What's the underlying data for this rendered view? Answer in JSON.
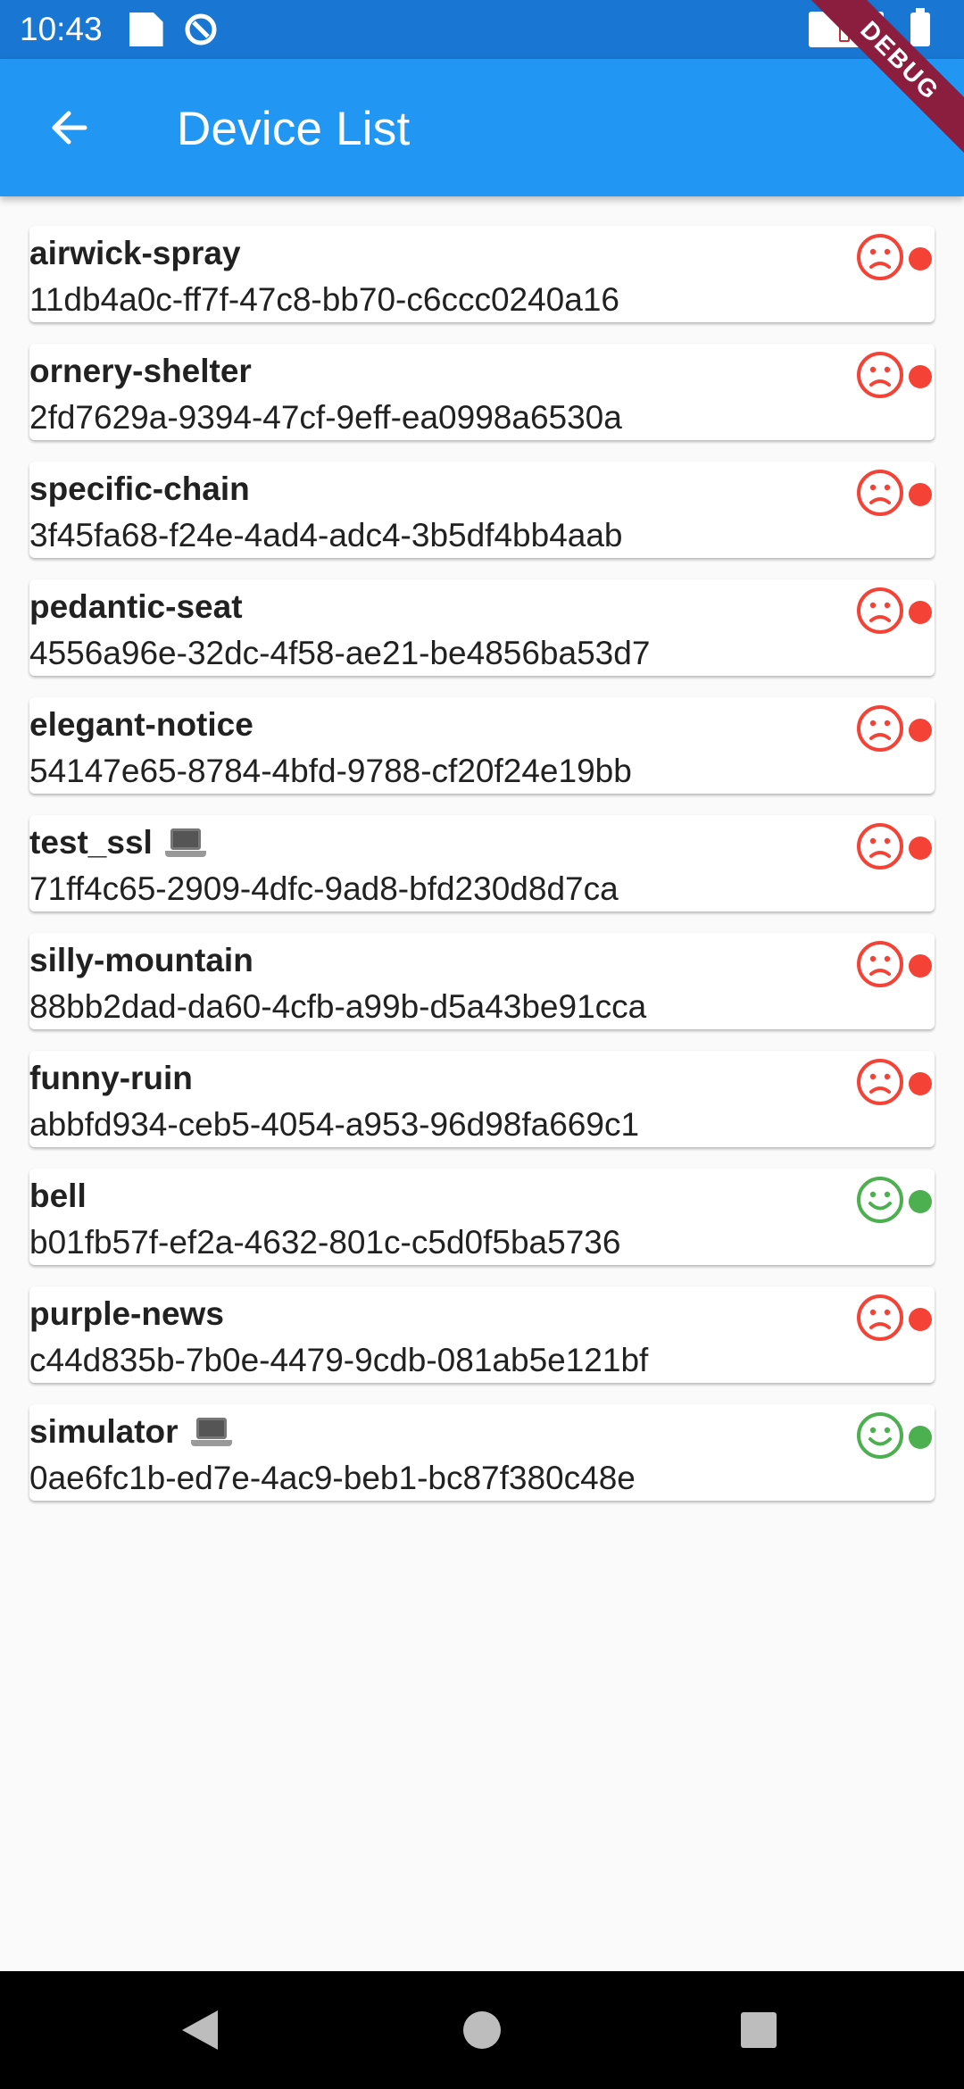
{
  "status_bar": {
    "time": "10:43",
    "icons": [
      "document-icon",
      "data-saver-icon",
      "sim-card-icon",
      "battery-icon"
    ]
  },
  "app_bar": {
    "title": "Device List",
    "back_icon": "arrow-back-icon",
    "debug_banner": "DEBUG"
  },
  "colors": {
    "app_bar": "#2196f3",
    "status_bar": "#1976d2",
    "offline": "#f44336",
    "online": "#4caf50"
  },
  "devices": [
    {
      "name": "airwick-spray",
      "id": "11db4a0c-ff7f-47c8-bb70-c6ccc0240a16",
      "laptop": false,
      "status": "offline",
      "mood": "sad-face-icon"
    },
    {
      "name": "ornery-shelter",
      "id": "2fd7629a-9394-47cf-9eff-ea0998a6530a",
      "laptop": false,
      "status": "offline",
      "mood": "sad-face-icon"
    },
    {
      "name": "specific-chain",
      "id": "3f45fa68-f24e-4ad4-adc4-3b5df4bb4aab",
      "laptop": false,
      "status": "offline",
      "mood": "sad-face-icon"
    },
    {
      "name": "pedantic-seat",
      "id": "4556a96e-32dc-4f58-ae21-be4856ba53d7",
      "laptop": false,
      "status": "offline",
      "mood": "sad-face-icon"
    },
    {
      "name": "elegant-notice",
      "id": "54147e65-8784-4bfd-9788-cf20f24e19bb",
      "laptop": false,
      "status": "offline",
      "mood": "sad-face-icon"
    },
    {
      "name": "test_ssl",
      "id": "71ff4c65-2909-4dfc-9ad8-bfd230d8d7ca",
      "laptop": true,
      "status": "offline",
      "mood": "sad-face-icon"
    },
    {
      "name": "silly-mountain",
      "id": "88bb2dad-da60-4cfb-a99b-d5a43be91cca",
      "laptop": false,
      "status": "offline",
      "mood": "sad-face-icon"
    },
    {
      "name": "funny-ruin",
      "id": "abbfd934-ceb5-4054-a953-96d98fa669c1",
      "laptop": false,
      "status": "offline",
      "mood": "sad-face-icon"
    },
    {
      "name": "bell",
      "id": "b01fb57f-ef2a-4632-801c-c5d0f5ba5736",
      "laptop": false,
      "status": "online",
      "mood": "happy-face-icon"
    },
    {
      "name": "purple-news",
      "id": "c44d835b-7b0e-4479-9cdb-081ab5e121bf",
      "laptop": false,
      "status": "offline",
      "mood": "sad-face-icon"
    },
    {
      "name": "simulator",
      "id": "0ae6fc1b-ed7e-4ac9-beb1-bc87f380c48e",
      "laptop": true,
      "status": "online",
      "mood": "happy-face-icon"
    }
  ],
  "nav_bar": {
    "icons": [
      "nav-back-icon",
      "nav-home-icon",
      "nav-recents-icon"
    ]
  }
}
